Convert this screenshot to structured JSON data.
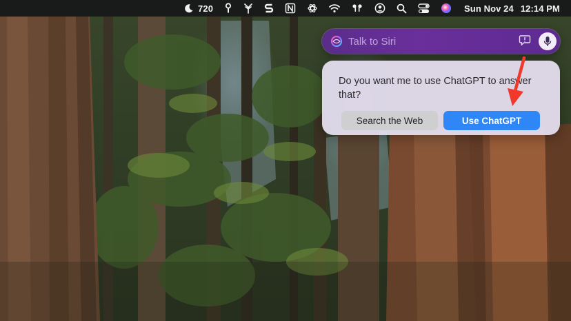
{
  "menubar": {
    "weather_value": "720",
    "clock_date": "Sun Nov 24",
    "clock_time": "12:14 PM",
    "icons": [
      "moon-icon",
      "pin-icon",
      "fork-icon",
      "scrivener-s-icon",
      "notion-icon",
      "chatgpt-icon",
      "wifi-icon",
      "airpods-icon",
      "user-icon",
      "search-icon",
      "control-center-icon",
      "siri-icon"
    ]
  },
  "siri": {
    "placeholder": "Talk to Siri",
    "accent_color": "#5e2a92"
  },
  "dialog": {
    "message": "Do you want me to use ChatGPT to answer that?",
    "search_web_label": "Search the Web",
    "use_chatgpt_label": "Use ChatGPT",
    "primary_color": "#2f86f6"
  },
  "annotation": {
    "arrow_color": "#f0392b"
  }
}
